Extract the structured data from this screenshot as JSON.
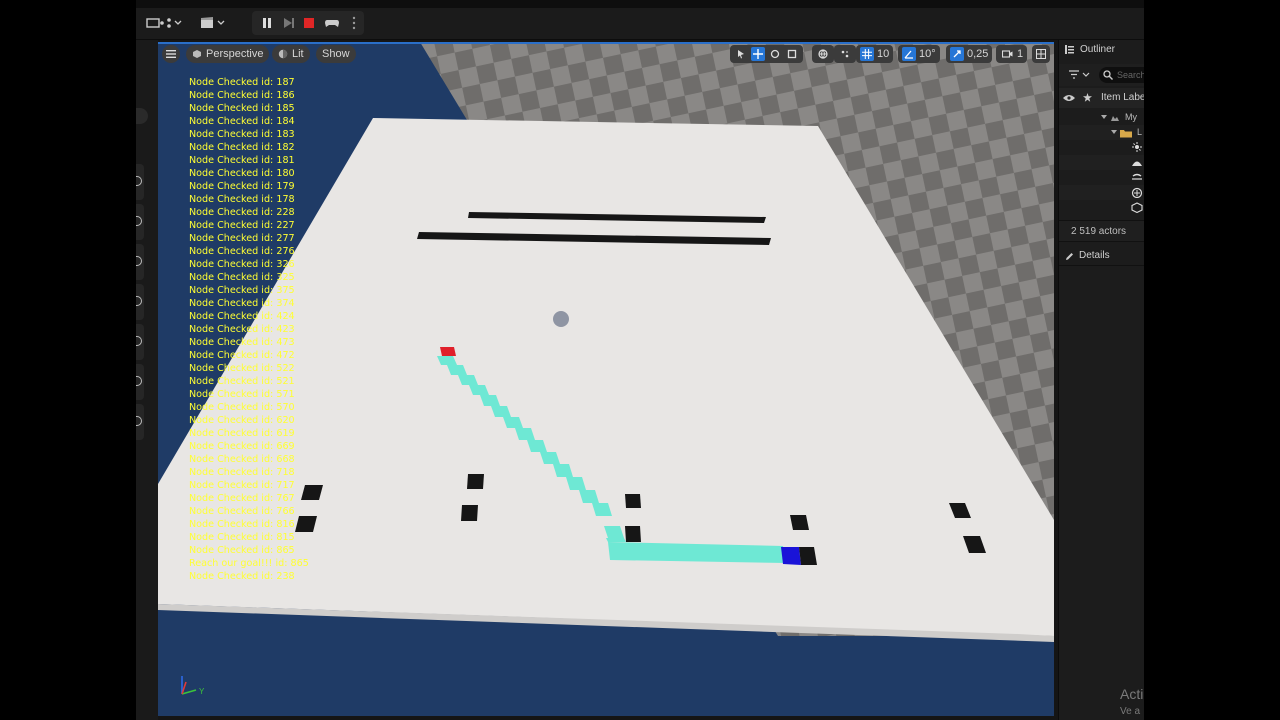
{
  "viewport": {
    "menu_icon": "hamburger-icon",
    "perspective_label": "Perspective",
    "lit_label": "Lit",
    "show_label": "Show",
    "grid_snap_value": "10",
    "rotation_snap_value": "10°",
    "scale_snap_value": "0,25",
    "camera_speed_value": "1"
  },
  "log": {
    "lines": [
      "Node Checked id: 187",
      "Node Checked id: 186",
      "Node Checked id: 185",
      "Node Checked id: 184",
      "Node Checked id: 183",
      "Node Checked id: 182",
      "Node Checked id: 181",
      "Node Checked id: 180",
      "Node Checked id: 179",
      "Node Checked id: 178",
      "Node Checked id: 228",
      "Node Checked id: 227",
      "Node Checked id: 277",
      "Node Checked id: 276",
      "Node Checked id: 326",
      "Node Checked id: 325",
      "Node Checked id: 375",
      "Node Checked id: 374",
      "Node Checked id: 424",
      "Node Checked id: 423",
      "Node Checked id: 473",
      "Node Checked id: 472",
      "Node Checked id: 522",
      "Node Checked id: 521",
      "Node Checked id: 571",
      "Node Checked id: 570",
      "Node Checked id: 620",
      "Node Checked id: 619",
      "Node Checked id: 669",
      "Node Checked id: 668",
      "Node Checked id: 718",
      "Node Checked id: 717",
      "Node Checked id: 767",
      "Node Checked id: 766",
      "Node Checked id: 816",
      "Node Checked id: 815",
      "Node Checked id: 865",
      "Reach our goal!!! id: 865",
      "Node Checked id: 238"
    ]
  },
  "outliner": {
    "title": "Outliner",
    "search_placeholder": "Search",
    "column_label": "Item Label",
    "world_label": "My",
    "folder_label": "L",
    "actor_count": "2 519 actors",
    "details_label": "Details"
  },
  "gizmo": {
    "y_label": "Y"
  },
  "watermark": {
    "line1": "Acti",
    "line2": "Ve a"
  },
  "colors": {
    "path": "#6ee8d4",
    "start": "#e0202a",
    "goal": "#1a13d8",
    "wall": "#161616",
    "floor": "#e8e6e4",
    "accent": "#2676d6"
  }
}
